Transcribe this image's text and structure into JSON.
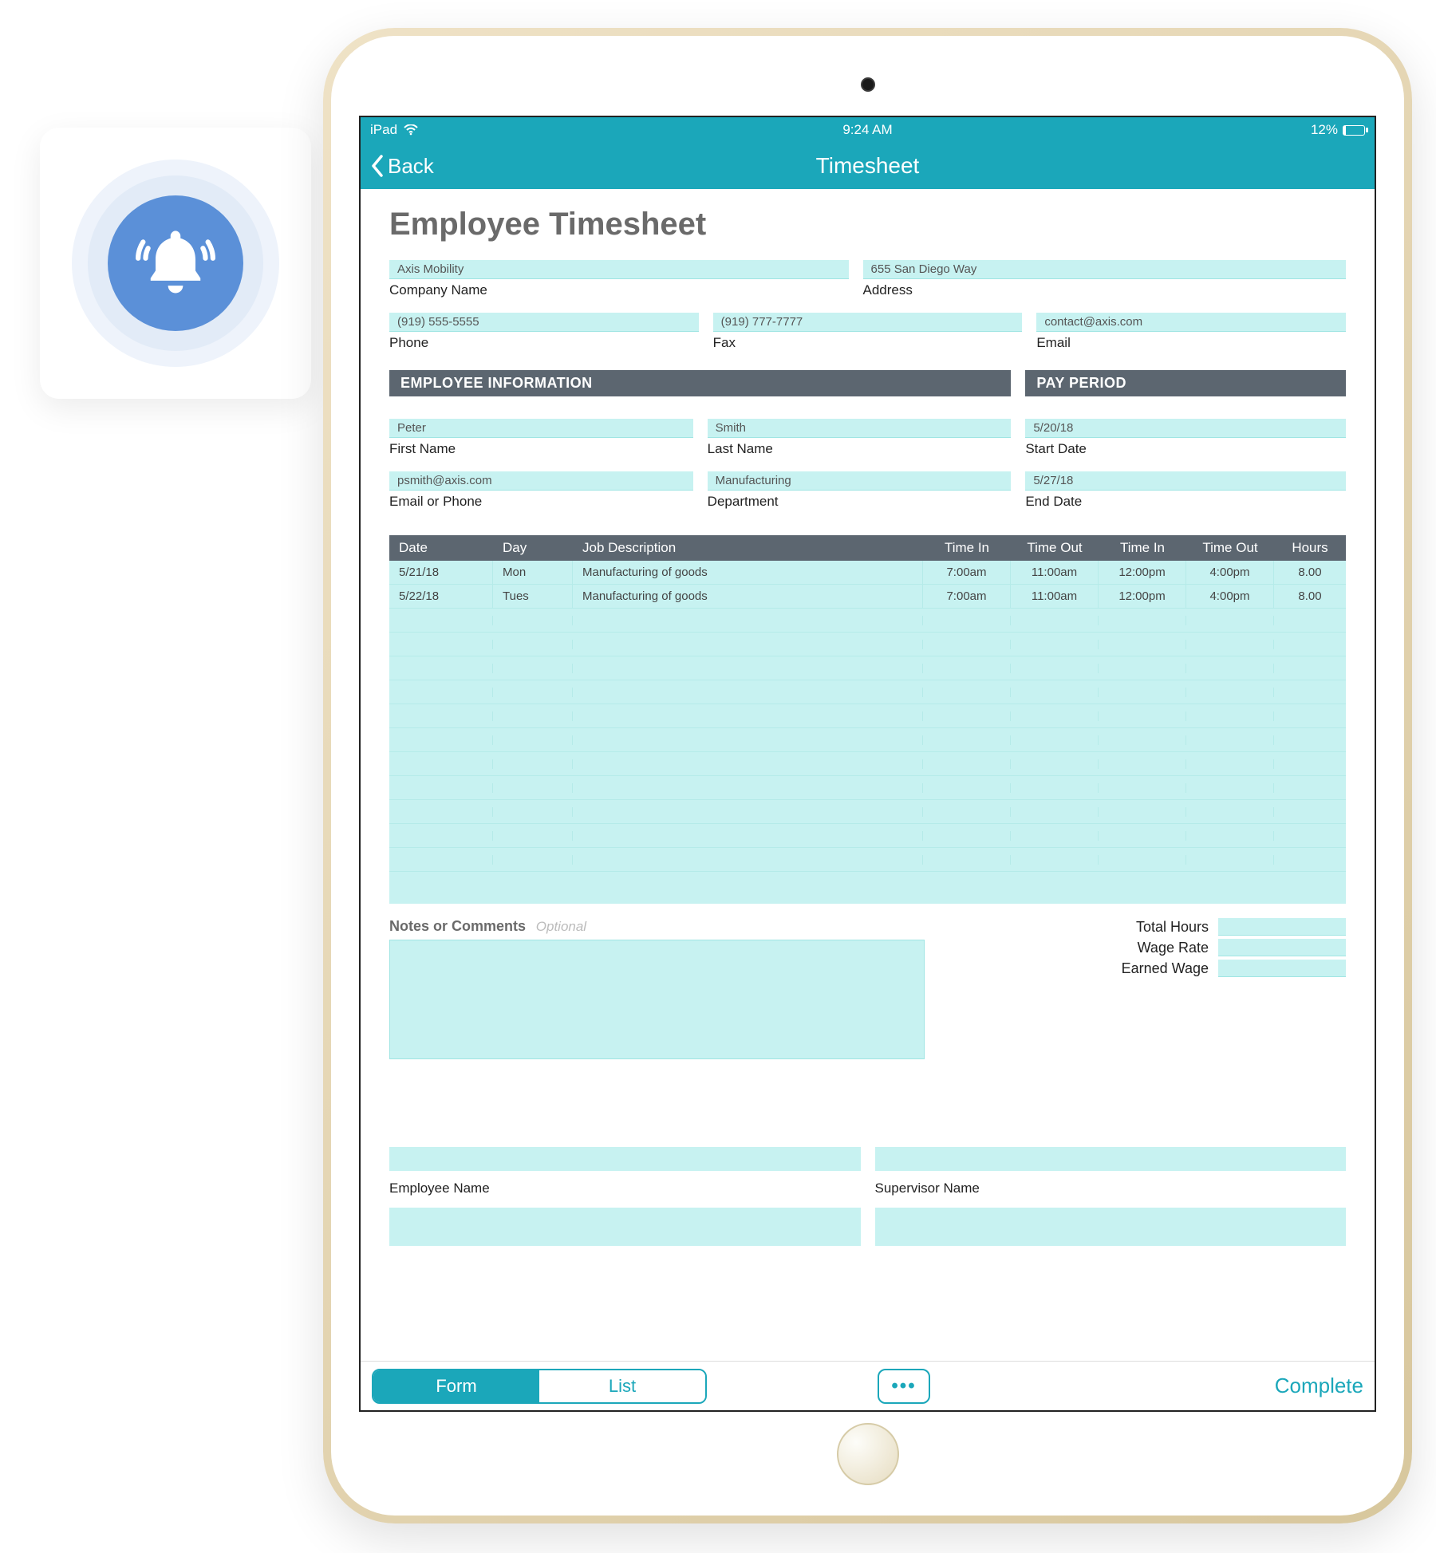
{
  "status": {
    "device": "iPad",
    "time": "9:24 AM",
    "battery_pct": "12%"
  },
  "nav": {
    "back": "Back",
    "title": "Timesheet"
  },
  "page": {
    "title": "Employee Timesheet"
  },
  "company": {
    "name_value": "Axis Mobility",
    "name_label": "Company Name",
    "address_value": "655 San Diego Way",
    "address_label": "Address",
    "phone_value": "(919) 555-5555",
    "phone_label": "Phone",
    "fax_value": "(919) 777-7777",
    "fax_label": "Fax",
    "email_value": "contact@axis.com",
    "email_label": "Email"
  },
  "sections": {
    "employee_info": "EMPLOYEE INFORMATION",
    "pay_period": "PAY PERIOD"
  },
  "employee": {
    "first_name_value": "Peter",
    "first_name_label": "First Name",
    "last_name_value": "Smith",
    "last_name_label": "Last Name",
    "email_value": "psmith@axis.com",
    "email_label": "Email or Phone",
    "dept_value": "Manufacturing",
    "dept_label": "Department"
  },
  "pay_period": {
    "start_value": "5/20/18",
    "start_label": "Start Date",
    "end_value": "5/27/18",
    "end_label": "End Date"
  },
  "table": {
    "headers": {
      "date": "Date",
      "day": "Day",
      "job": "Job Description",
      "time_in1": "Time In",
      "time_out1": "Time Out",
      "time_in2": "Time In",
      "time_out2": "Time Out",
      "hours": "Hours"
    },
    "rows": [
      {
        "date": "5/21/18",
        "day": "Mon",
        "job": "Manufacturing of goods",
        "ti1": "7:00am",
        "to1": "11:00am",
        "ti2": "12:00pm",
        "to2": "4:00pm",
        "hours": "8.00"
      },
      {
        "date": "5/22/18",
        "day": "Tues",
        "job": "Manufacturing of goods",
        "ti1": "7:00am",
        "to1": "11:00am",
        "ti2": "12:00pm",
        "to2": "4:00pm",
        "hours": "8.00"
      }
    ]
  },
  "notes": {
    "label": "Notes or Comments",
    "optional": "Optional"
  },
  "totals": {
    "total_hours": "Total Hours",
    "wage_rate": "Wage Rate",
    "earned_wage": "Earned Wage"
  },
  "sig": {
    "employee": "Employee Name",
    "supervisor": "Supervisor Name"
  },
  "toolbar": {
    "form": "Form",
    "list": "List",
    "complete": "Complete"
  }
}
